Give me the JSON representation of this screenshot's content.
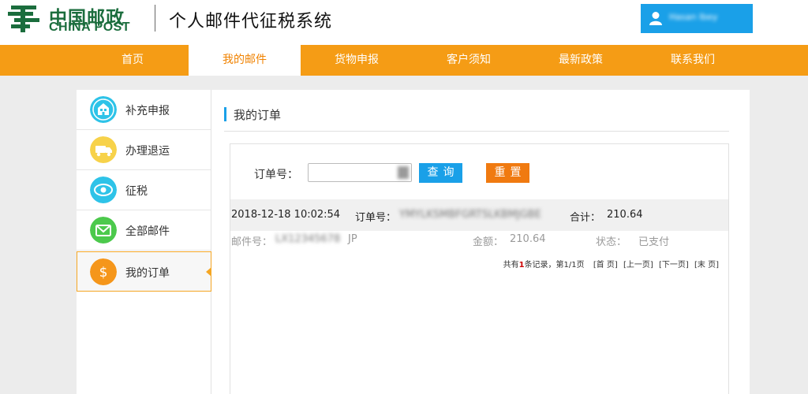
{
  "header": {
    "logo_cn": "中国邮政",
    "logo_en": "CHINA POST",
    "system_title": "个人邮件代征税系统",
    "user_name": "Hasan Ibey",
    "accent_color": "#1aa0e8"
  },
  "nav": {
    "items": [
      {
        "label": "首页"
      },
      {
        "label": "我的邮件"
      },
      {
        "label": "货物申报"
      },
      {
        "label": "客户须知"
      },
      {
        "label": "最新政策"
      },
      {
        "label": "联系我们"
      }
    ],
    "active_index": 1,
    "color": "#f59c15"
  },
  "sidebar": {
    "items": [
      {
        "label": "补充申报",
        "icon": "building-icon"
      },
      {
        "label": "办理退运",
        "icon": "truck-icon"
      },
      {
        "label": "征税",
        "icon": "eye-icon"
      },
      {
        "label": "全部邮件",
        "icon": "envelope-icon"
      },
      {
        "label": "我的订单",
        "icon": "dollar-icon"
      }
    ],
    "active_index": 4
  },
  "main": {
    "title": "我的订单",
    "search": {
      "label": "订单号：",
      "value": "",
      "query_label": "查询",
      "reset_label": "重置"
    },
    "order": {
      "datetime": "2018-12-18 10:02:54",
      "order_no_label": "订单号：",
      "order_no": "YMYLKSMBFGRTSLKBMJGBE",
      "total_label": "合计：",
      "total": "210.64",
      "mail_no_label": "邮件号：",
      "mail_no": "LX12345678",
      "mail_no_suffix": "JP",
      "amount_label": "金额：",
      "amount": "210.64",
      "status_label": "状态：",
      "status": "已支付"
    },
    "pager": {
      "prefix": "共有",
      "count": "1",
      "suffix": "条记录，第1/1页",
      "first": "[首 页]",
      "prev": "[上一页]",
      "next": "[下一页]",
      "last": "[末 页]"
    }
  }
}
